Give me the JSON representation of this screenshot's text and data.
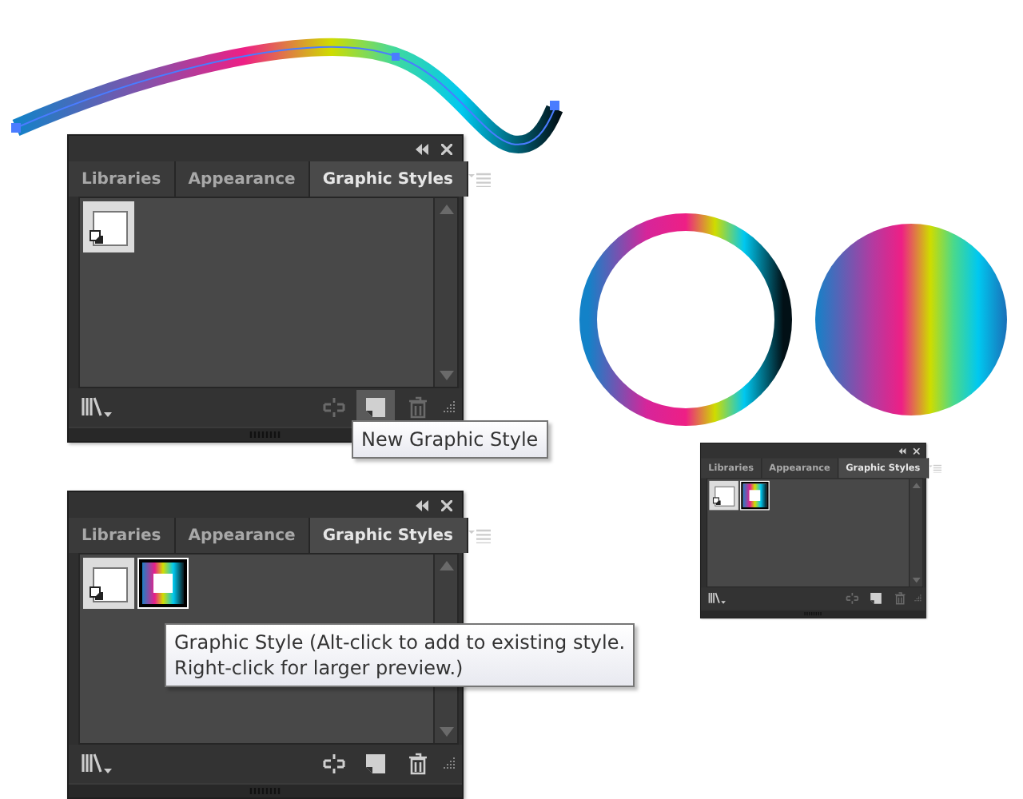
{
  "panels": [
    {
      "tabs": [
        {
          "label": "Libraries",
          "selected": false
        },
        {
          "label": "Appearance",
          "selected": false
        },
        {
          "label": "Graphic Styles",
          "selected": true
        }
      ],
      "swatches": [
        {
          "kind": "default",
          "selected": false
        }
      ],
      "buttons": [
        {
          "kind": "break-link",
          "disabled": true,
          "highlighted": false
        },
        {
          "kind": "new",
          "disabled": false,
          "highlighted": true
        },
        {
          "kind": "delete",
          "disabled": true,
          "highlighted": false
        }
      ]
    },
    {
      "tabs": [
        {
          "label": "Libraries",
          "selected": false
        },
        {
          "label": "Appearance",
          "selected": false
        },
        {
          "label": "Graphic Styles",
          "selected": true
        }
      ],
      "swatches": [
        {
          "kind": "default",
          "selected": false
        },
        {
          "kind": "gradient",
          "selected": true
        }
      ],
      "buttons": [
        {
          "kind": "break-link",
          "disabled": false,
          "highlighted": false
        },
        {
          "kind": "new",
          "disabled": false,
          "highlighted": false
        },
        {
          "kind": "delete",
          "disabled": false,
          "highlighted": false
        }
      ]
    },
    {
      "tabs": [
        {
          "label": "Libraries",
          "selected": false
        },
        {
          "label": "Appearance",
          "selected": false
        },
        {
          "label": "Graphic Styles",
          "selected": true
        }
      ],
      "swatches": [
        {
          "kind": "default",
          "selected": false
        },
        {
          "kind": "gradient",
          "selected": true
        }
      ],
      "buttons": [
        {
          "kind": "break-link",
          "disabled": true,
          "highlighted": false
        },
        {
          "kind": "new",
          "disabled": false,
          "highlighted": false
        },
        {
          "kind": "delete",
          "disabled": true,
          "highlighted": false
        }
      ]
    }
  ],
  "tooltips": [
    {
      "lines": [
        "New Graphic Style"
      ]
    },
    {
      "lines": [
        "Graphic Style (Alt-click to add to existing style.",
        "Right-click for larger preview.)"
      ]
    }
  ]
}
